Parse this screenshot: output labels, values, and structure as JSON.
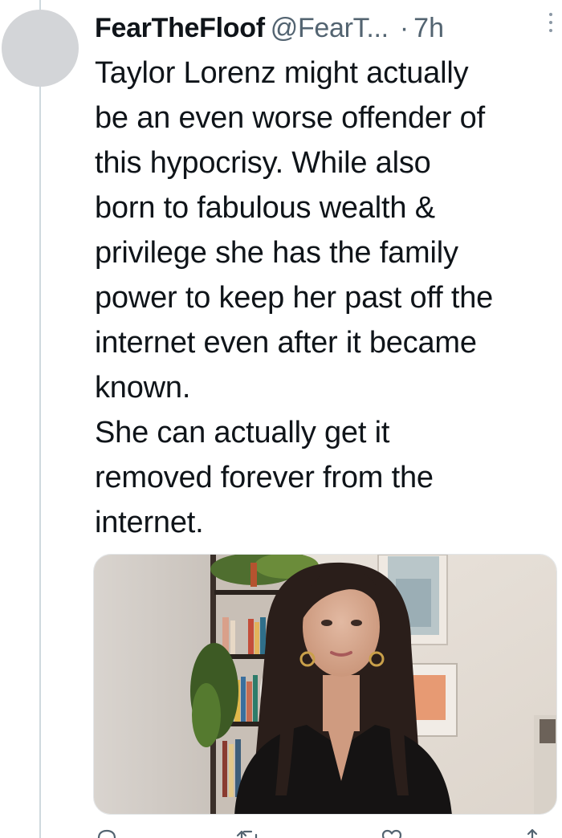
{
  "tweet": {
    "author": {
      "display_name": "FearTheFloof",
      "handle": "@FearT...",
      "separator": "·",
      "time": "7h"
    },
    "text_lines": [
      "Taylor Lorenz might actually",
      "be an even worse offender of",
      "this hypocrisy. While also",
      "born to fabulous wealth &",
      "privilege she has the family",
      "power to keep her past off the",
      "internet even after it became",
      "known.",
      "She can actually get it",
      "removed forever from the",
      "internet."
    ],
    "media": {
      "type": "photo"
    },
    "actions": [
      {
        "name": "reply",
        "icon": "reply-icon"
      },
      {
        "name": "retweet",
        "icon": "retweet-icon"
      },
      {
        "name": "like",
        "icon": "heart-icon"
      },
      {
        "name": "share",
        "icon": "share-icon"
      }
    ]
  },
  "colors": {
    "text_primary": "#0f1419",
    "text_secondary": "#536471",
    "thread_line": "#cfd9de",
    "avatar_placeholder": "#d3d5d8"
  }
}
